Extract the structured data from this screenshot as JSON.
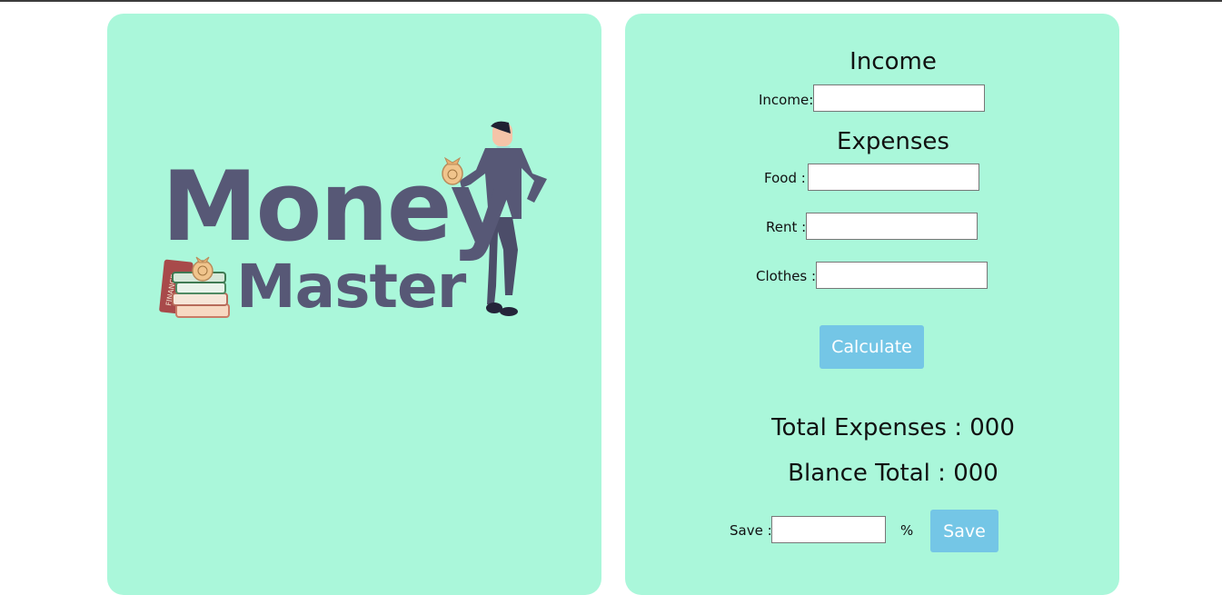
{
  "logo": {
    "word1": "Money",
    "word2": "Master",
    "book_text": "FINANCE",
    "currency_symbol": "₹",
    "text_color": "#575876"
  },
  "form": {
    "income_heading": "Income",
    "income_label": "Income:",
    "income_value": "",
    "expenses_heading": "Expenses",
    "food_label": "Food :",
    "food_value": "",
    "rent_label": "Rent :",
    "rent_value": "",
    "clothes_label": "Clothes :",
    "clothes_value": "",
    "calculate_label": "Calculate",
    "total_expenses_label": "Total Expenses :",
    "total_expenses_value": "000",
    "balance_label": "Blance Total :",
    "balance_value": "000",
    "save_label": "Save :",
    "save_value": "",
    "percent_sign": "%",
    "save_button_label": "Save"
  },
  "colors": {
    "card_bg": "#aaf7da",
    "button_bg": "#74c6e6",
    "top_border": "#3c3c3c"
  }
}
